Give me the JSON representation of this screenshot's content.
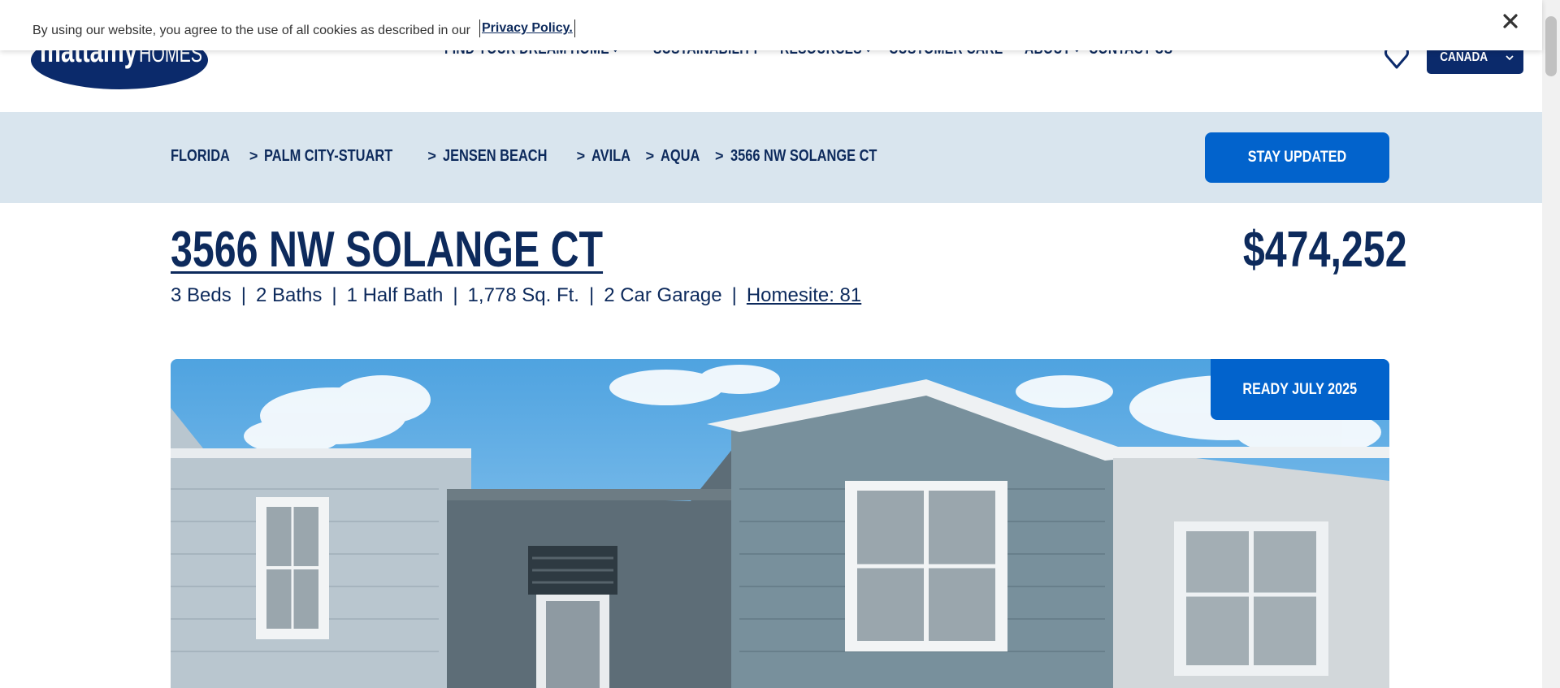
{
  "cookie": {
    "text": "By using our website, you agree to the use of all cookies as described in our",
    "link_label": "Privacy Policy."
  },
  "header": {
    "logo_text": "mattamyHOMES",
    "nav": [
      {
        "label": "FIND YOUR DREAM HOME",
        "has_dropdown": true
      },
      {
        "label": "SUSTAINABILITY",
        "has_dropdown": false
      },
      {
        "label": "RESOURCES",
        "has_dropdown": true
      },
      {
        "label": "CUSTOMER CARE",
        "has_dropdown": false
      },
      {
        "label": "ABOUT",
        "has_dropdown": true
      },
      {
        "label": "CONTACT US",
        "has_dropdown": false
      }
    ],
    "favorites_icon": "heart-icon",
    "country_label": "CANADA"
  },
  "breadcrumb": {
    "items": [
      "FLORIDA",
      "PALM CITY-STUART",
      "JENSEN BEACH",
      "AVILA",
      "AQUA",
      "3566 NW SOLANGE CT"
    ],
    "separator": ">"
  },
  "stay_updated_label": "STAY UPDATED",
  "listing": {
    "address": "3566 NW SOLANGE CT",
    "price": "$474,252",
    "beds": "3 Beds",
    "baths": "2 Baths",
    "half_bath": "1 Half Bath",
    "sqft": "1,778 Sq. Ft.",
    "garage": "2 Car Garage",
    "homesite": "Homesite: 81",
    "separator": "|",
    "badge": "READY JULY 2025"
  },
  "colors": {
    "navy": "#0d2a5c",
    "brand_blue": "#0263cc",
    "crumb_bg": "#d9e5ee",
    "country_btn": "#0b2a6b"
  }
}
